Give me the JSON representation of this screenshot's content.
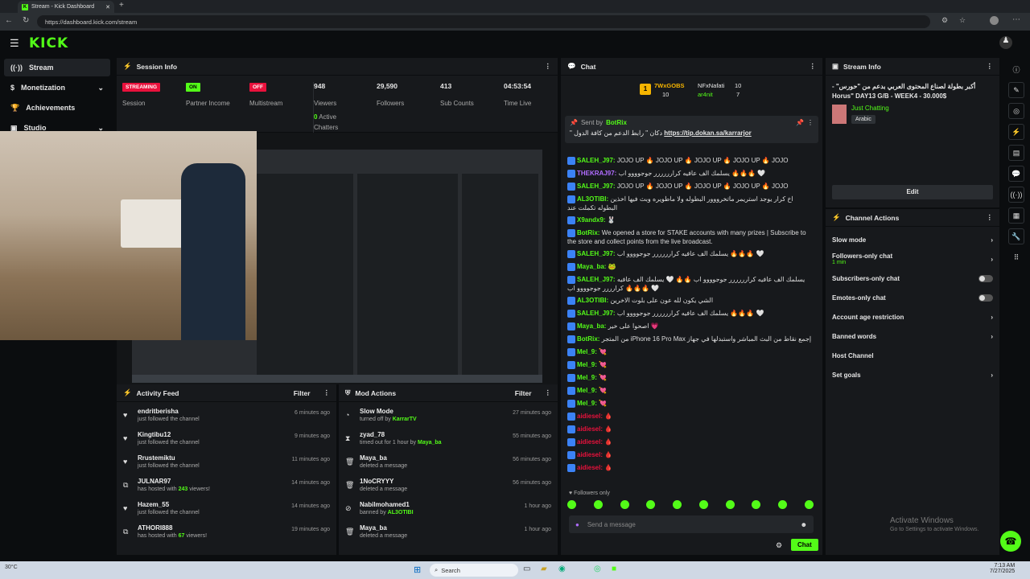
{
  "browser": {
    "tab_title": "Stream - Kick Dashboard",
    "url": "https://dashboard.kick.com/stream"
  },
  "nav": {
    "logo": "KICK"
  },
  "sidebar": {
    "items": [
      {
        "label": "Stream"
      },
      {
        "label": "Monetization"
      },
      {
        "label": "Achievements"
      },
      {
        "label": "Studio"
      }
    ]
  },
  "session": {
    "title": "Session Info",
    "stats": [
      {
        "value": "STREAMING",
        "label": "Session"
      },
      {
        "value": "ON",
        "label": "Partner Income"
      },
      {
        "value": "OFF",
        "label": "Multistream"
      },
      {
        "value": "948",
        "label": "Viewers",
        "sub_value": "0",
        "sub_label": "Active Chatters"
      },
      {
        "value": "29,590",
        "label": "Followers"
      },
      {
        "value": "413",
        "label": "Sub Counts"
      },
      {
        "value": "04:53:54",
        "label": "Time Live"
      }
    ]
  },
  "activity": {
    "title": "Activity Feed",
    "filter": "Filter",
    "items": [
      {
        "name": "endritberisha",
        "sub": "just followed the channel",
        "time": "6 minutes ago",
        "icon": "heart-icon"
      },
      {
        "name": "Kingtibu12",
        "sub": "just followed the channel",
        "time": "9 minutes ago",
        "icon": "heart-icon"
      },
      {
        "name": "Rrustemiktu",
        "sub": "just followed the channel",
        "time": "11 minutes ago",
        "icon": "heart-icon"
      },
      {
        "name": "JULNAR97",
        "sub": "has hosted with",
        "count": "243",
        "sub2": "viewers!",
        "time": "14 minutes ago",
        "icon": "host-icon"
      },
      {
        "name": "Hazem_55",
        "sub": "just followed the channel",
        "time": "14 minutes ago",
        "icon": "heart-icon"
      },
      {
        "name": "ATHORI888",
        "sub": "has hosted with",
        "count": "67",
        "sub2": "viewers!",
        "time": "19 minutes ago",
        "icon": "host-icon"
      }
    ]
  },
  "mod": {
    "title": "Mod Actions",
    "filter": "Filter",
    "items": [
      {
        "name": "Slow Mode",
        "sub": "turned off by",
        "by": "KarrarTV",
        "time": "27 minutes ago"
      },
      {
        "name": "zyad_78",
        "sub": "timed out for 1 hour by",
        "by": "Maya_ba",
        "time": "55 minutes ago"
      },
      {
        "name": "Maya_ba",
        "sub": "deleted a message",
        "by": "",
        "time": "56 minutes ago"
      },
      {
        "name": "1NoCRYYY",
        "sub": "deleted a message",
        "by": "",
        "time": "56 minutes ago"
      },
      {
        "name": "Nabilmohamed1",
        "sub": "banned by",
        "by": "AL3OTIBI",
        "time": "1 hour ago"
      },
      {
        "name": "Maya_ba",
        "sub": "deleted a message",
        "by": "",
        "time": "1 hour ago"
      }
    ]
  },
  "chat": {
    "title": "Chat",
    "leaders": [
      {
        "name": "7WxGOBS",
        "count": "10"
      },
      {
        "name": "NFxNafati",
        "count": "10"
      },
      {
        "name": "ar4nit",
        "count": "7"
      }
    ],
    "leader_rank": "1",
    "pinned": {
      "sent_by_label": "Sent by",
      "user": "BotRix",
      "text": "\" دكان \" رابط الدعم من كافة الدول",
      "link": "https://tip.dokan.sa/karrarjor"
    },
    "messages": [
      {
        "user": "SALEH_J97:",
        "color": "#53fc18",
        "text": "JOJO UP 🔥 JOJO UP 🔥 JOJO UP 🔥 JOJO UP 🔥 JOJO"
      },
      {
        "user": "THEKRAJ97:",
        "color": "#b06cff",
        "text": "يسلمك الف عافيه كرارررررر جوجوووو اب 🔥🔥🔥 🤍"
      },
      {
        "user": "SALEH_J97:",
        "color": "#53fc18",
        "text": "JOJO UP 🔥 JOJO UP 🔥 JOJO UP 🔥 JOJO UP 🔥 JOJO"
      },
      {
        "user": "AL3OTIBI:",
        "color": "#53fc18",
        "text": "اخ كرار يوجد استريمر ماتخرووور البطوله ولا ماطويره وبث فيها اخذين البطوله تكملت عند"
      },
      {
        "user": "X9andx9:",
        "color": "#53fc18",
        "text": "🐰"
      },
      {
        "user": "BotRix:",
        "color": "#53fc18",
        "text": "We opened a store for STAKE accounts with many prizes | Subscribe to the store and collect points from the live broadcast."
      },
      {
        "user": "SALEH_J97:",
        "color": "#53fc18",
        "text": "يسلمك الف عافيه كرارررررر جوجوووو اب 🔥🔥🔥 🤍"
      },
      {
        "user": "Maya_ba:",
        "color": "#53fc18",
        "text": "🐸"
      },
      {
        "user": "SALEH_J97:",
        "color": "#53fc18",
        "text": "يسلمك الف عافيه كرارررررر جوجوووو اب 🔥🔥 🤍 يسلمك الف عافيه كرارررر جوجوووو اب 🔥🔥🔥 🤍"
      },
      {
        "user": "AL3OTIBI:",
        "color": "#53fc18",
        "text": "الشي يكون لله عون على بلوت الاخرين"
      },
      {
        "user": "SALEH_J97:",
        "color": "#53fc18",
        "text": "يسلمك الف عافيه كرارررررر جوجوووو اب 🔥🔥🔥 🤍"
      },
      {
        "user": "Maya_ba:",
        "color": "#53fc18",
        "text": "اصحوا على خير 💗"
      },
      {
        "user": "BotRix:",
        "color": "#53fc18",
        "text": "من المتجر iPhone 16 Pro Max إجمع نقاط من البث المباشر واستبدلها في جهاز"
      },
      {
        "user": "Mel_9:",
        "color": "#53fc18",
        "text": "💘"
      },
      {
        "user": "Mel_9:",
        "color": "#53fc18",
        "text": "💘"
      },
      {
        "user": "Mel_9:",
        "color": "#53fc18",
        "text": "💘"
      },
      {
        "user": "Mel_9:",
        "color": "#53fc18",
        "text": "💘"
      },
      {
        "user": "Mel_9:",
        "color": "#53fc18",
        "text": "💘"
      },
      {
        "user": "aidiesel:",
        "color": "#e9113c",
        "text": "🩸"
      },
      {
        "user": "aidiesel:",
        "color": "#e9113c",
        "text": "🩸"
      },
      {
        "user": "aidiesel:",
        "color": "#e9113c",
        "text": "🩸"
      },
      {
        "user": "aidiesel:",
        "color": "#e9113c",
        "text": "🩸"
      },
      {
        "user": "aidiesel:",
        "color": "#e9113c",
        "text": "🩸"
      }
    ],
    "followers_only": "Followers only",
    "placeholder": "Send a message",
    "send": "Chat"
  },
  "stream_info": {
    "title": "Stream Info",
    "stream_title": "أكبر بطولة لصناع المحتوى العربي بدعم من \"حورس\" - Horus\" DAY13 G/B - WEEK4 - 30.000$",
    "category": "Just Chatting",
    "tag": "Arabic",
    "edit": "Edit"
  },
  "channel_actions": {
    "title": "Channel Actions",
    "items": [
      {
        "label": "Slow mode",
        "type": "arrow"
      },
      {
        "label": "Followers-only chat",
        "sub": "1 min",
        "type": "arrow"
      },
      {
        "label": "Subscribers-only chat",
        "type": "toggle"
      },
      {
        "label": "Emotes-only chat",
        "type": "toggle"
      },
      {
        "label": "Account age restriction",
        "type": "arrow"
      },
      {
        "label": "Banned words",
        "type": "arrow"
      },
      {
        "label": "Host Channel",
        "type": "none"
      },
      {
        "label": "Set goals",
        "type": "arrow"
      }
    ]
  },
  "watermark": {
    "line1": "Activate Windows",
    "line2": "Go to Settings to activate Windows."
  },
  "taskbar": {
    "search": "Search",
    "weather_temp": "30°C",
    "time": "7:13 AM",
    "date": "7/27/2025"
  },
  "colors": {
    "accent": "#53fc18",
    "danger": "#e9113c",
    "panel": "#17191c"
  }
}
